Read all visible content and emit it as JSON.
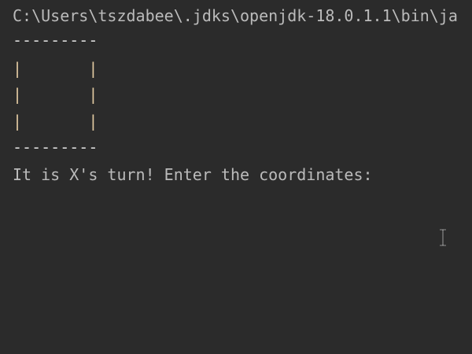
{
  "console": {
    "command_line": "C:\\Users\\tszdabee\\.jdks\\openjdk-18.0.1.1\\bin\\ja",
    "board_top": "---------",
    "rows": [
      {
        "left": "|",
        "cells": "       ",
        "right": "|"
      },
      {
        "left": "|",
        "cells": "       ",
        "right": "|"
      },
      {
        "left": "|",
        "cells": "       ",
        "right": "|"
      }
    ],
    "board_bottom": "---------",
    "prompt": "It is X's turn! Enter the coordinates:"
  },
  "colors": {
    "background": "#2b2b2b",
    "text": "#bbbbbb",
    "pipe": "#e0c8a0"
  },
  "icons": {
    "mouse_cursor": "text-cursor-icon"
  }
}
